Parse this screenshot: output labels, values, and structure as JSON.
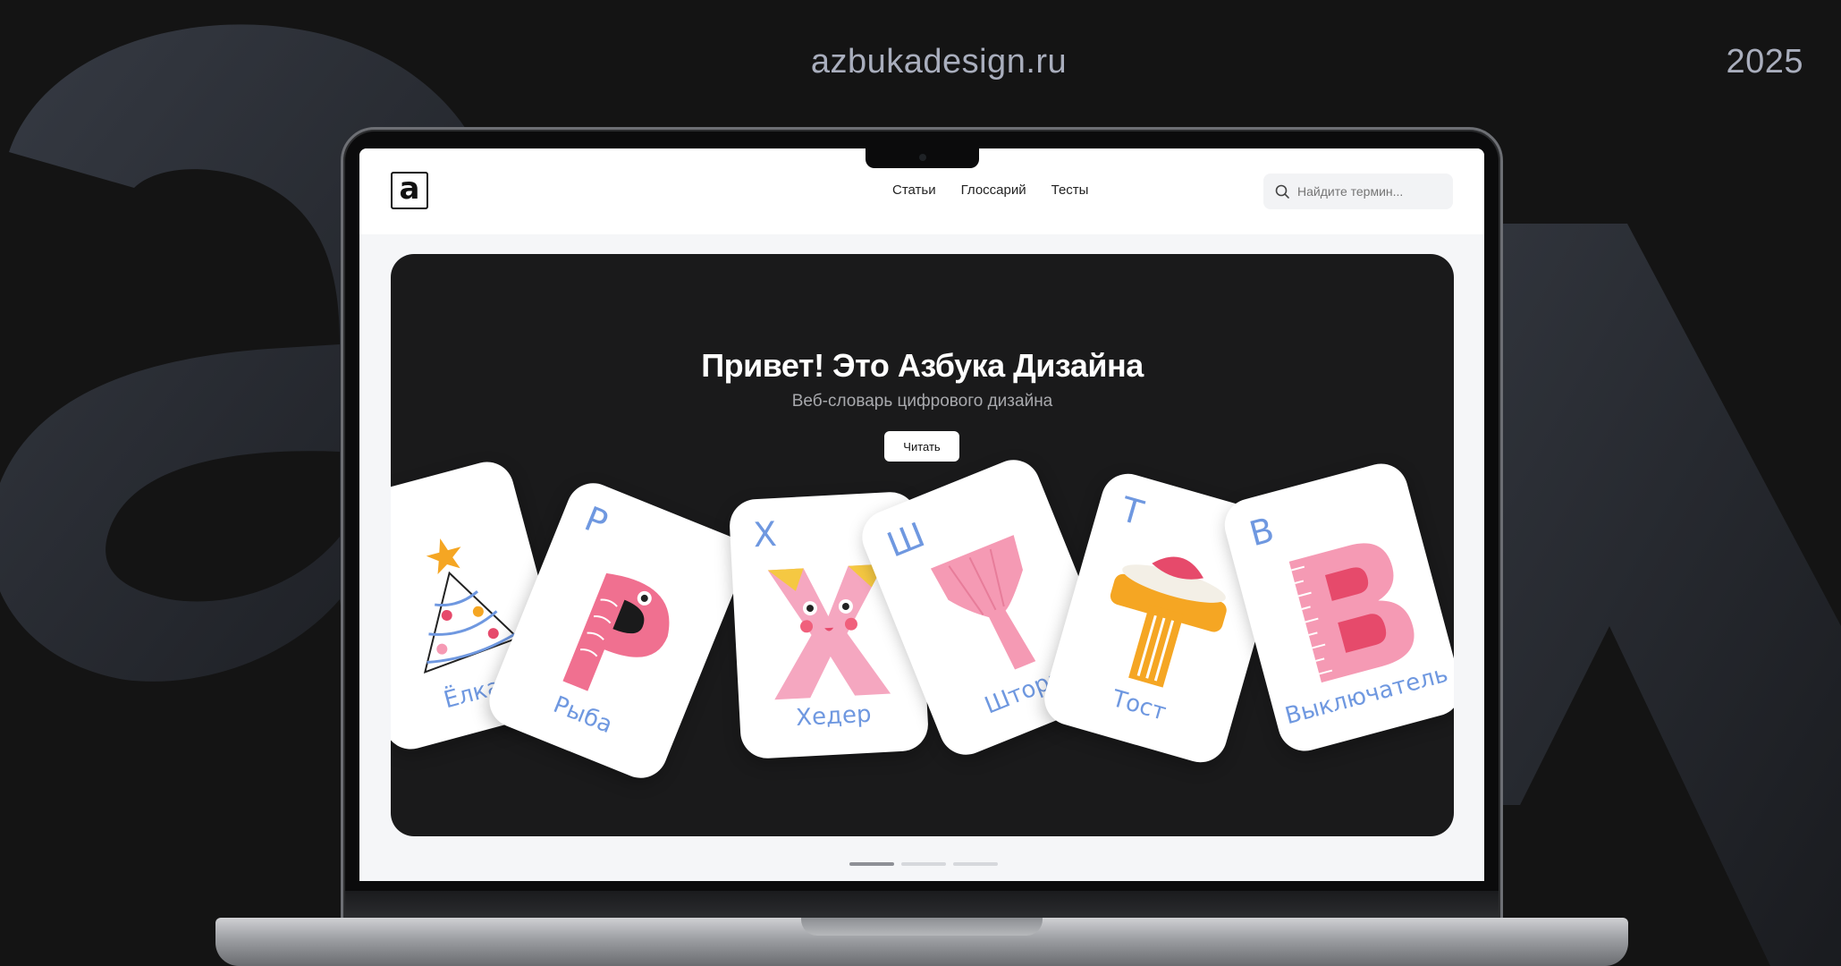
{
  "header": {
    "site": "azbukadesign.ru",
    "year": "2025"
  },
  "screen": {
    "logo_letter": "a",
    "nav": [
      "Статьи",
      "Глоссарий",
      "Тесты"
    ],
    "search": {
      "placeholder": "Найдите термин...",
      "icon": "search-icon"
    },
    "hero": {
      "title": "Привет! Это Азбука Дизайна",
      "subtitle": "Веб-словарь цифрового дизайна",
      "button": "Читать"
    },
    "cards": [
      {
        "letter": "",
        "word": "Ёлка",
        "art": "christmas-tree"
      },
      {
        "letter": "Р",
        "word": "Рыба",
        "art": "fish-letter-r"
      },
      {
        "letter": "Х",
        "word": "Хедер",
        "art": "face-letter-x"
      },
      {
        "letter": "Ш",
        "word": "Штора",
        "art": "curtain"
      },
      {
        "letter": "Т",
        "word": "Тост",
        "art": "toast-letter-t"
      },
      {
        "letter": "В",
        "word": "Выключатель",
        "art": "ruler-letter-v"
      }
    ],
    "pagination": {
      "count": 3,
      "active": 0
    }
  },
  "colors": {
    "accent": "#6f98e0",
    "pink": "#f59ab4",
    "hero_bg": "#1a1a1b"
  }
}
